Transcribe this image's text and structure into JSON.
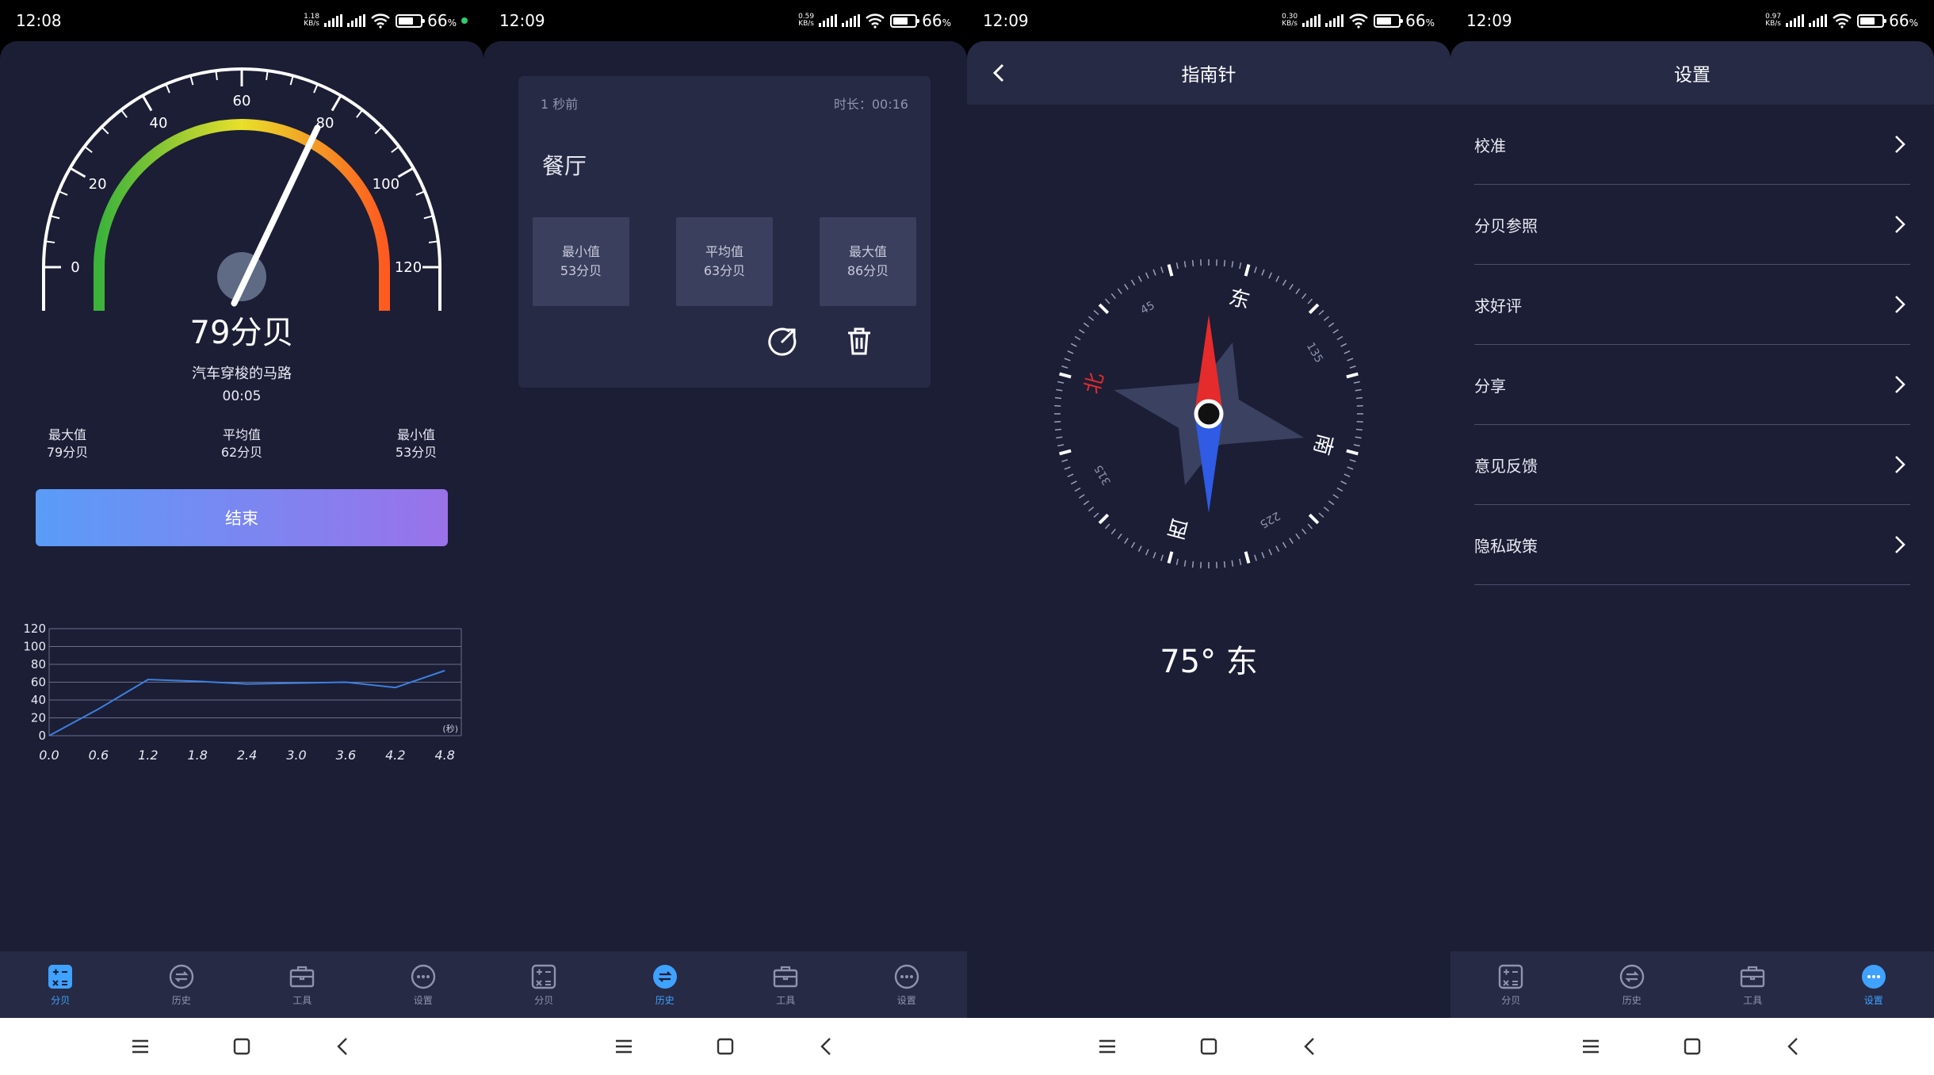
{
  "status": [
    {
      "time": "12:08",
      "speed_top": "1.18",
      "speed_bottom": "KB/s",
      "battery": "66"
    },
    {
      "time": "12:09",
      "speed_top": "0.59",
      "speed_bottom": "KB/s",
      "battery": "66"
    },
    {
      "time": "12:09",
      "speed_top": "0.30",
      "speed_bottom": "KB/s",
      "battery": "66"
    },
    {
      "time": "12:09",
      "speed_top": "0.97",
      "speed_bottom": "KB/s",
      "battery": "66"
    }
  ],
  "battery_unit": "%",
  "tabs": [
    {
      "label": "分贝",
      "icon": "calculator-icon"
    },
    {
      "label": "历史",
      "icon": "history-icon"
    },
    {
      "label": "工具",
      "icon": "toolbox-icon"
    },
    {
      "label": "设置",
      "icon": "more-icon"
    }
  ],
  "meter": {
    "gauge_value": 79,
    "gauge_max": 120,
    "gauge_ticks": [
      "0",
      "20",
      "40",
      "60",
      "80",
      "100",
      "120"
    ],
    "value_text": "79分贝",
    "environment": "汽车穿梭的马路",
    "timer": "00:05",
    "stats": [
      {
        "label": "最大值",
        "value": "79分贝"
      },
      {
        "label": "平均值",
        "value": "62分贝"
      },
      {
        "label": "最小值",
        "value": "53分贝"
      }
    ],
    "end_label": "结束"
  },
  "chart_data": {
    "type": "line",
    "x": [
      0.0,
      0.6,
      1.2,
      1.8,
      2.4,
      3.0,
      3.6,
      4.2,
      4.8
    ],
    "values": [
      0,
      30,
      63,
      61,
      58,
      59,
      60,
      54,
      73
    ],
    "x_ticks": [
      "0.0",
      "0.6",
      "1.2",
      "1.8",
      "2.4",
      "3.0",
      "3.6",
      "4.2",
      "4.8"
    ],
    "y_ticks": [
      "0",
      "20",
      "40",
      "60",
      "80",
      "100",
      "120"
    ],
    "unit_label": "(秒)",
    "ylim": [
      0,
      120
    ],
    "xlim": [
      0,
      5.0
    ],
    "line_color": "#3d7fe0",
    "grid": true
  },
  "history": {
    "ago": "1 秒前",
    "duration": "时长：00:16",
    "place": "餐厅",
    "stats": [
      {
        "label": "最小值",
        "value": "53分贝"
      },
      {
        "label": "平均值",
        "value": "63分贝"
      },
      {
        "label": "最大值",
        "value": "86分贝"
      }
    ]
  },
  "compass": {
    "title": "指南针",
    "heading_deg": 75,
    "heading_text": "75° 东",
    "cardinals": {
      "north": "北",
      "east": "东",
      "south": "南",
      "west": "西"
    },
    "degree_labels": [
      "45",
      "135",
      "225",
      "315"
    ]
  },
  "settings": {
    "title": "设置",
    "items": [
      "校准",
      "分贝参照",
      "求好评",
      "分享",
      "意见反馈",
      "隐私政策"
    ]
  },
  "colors": {
    "background": "#1b1e35",
    "panel": "#262a45",
    "accent": "#3fa2ff",
    "needle_north": "#e52b2b",
    "needle_south": "#2f5be5"
  }
}
